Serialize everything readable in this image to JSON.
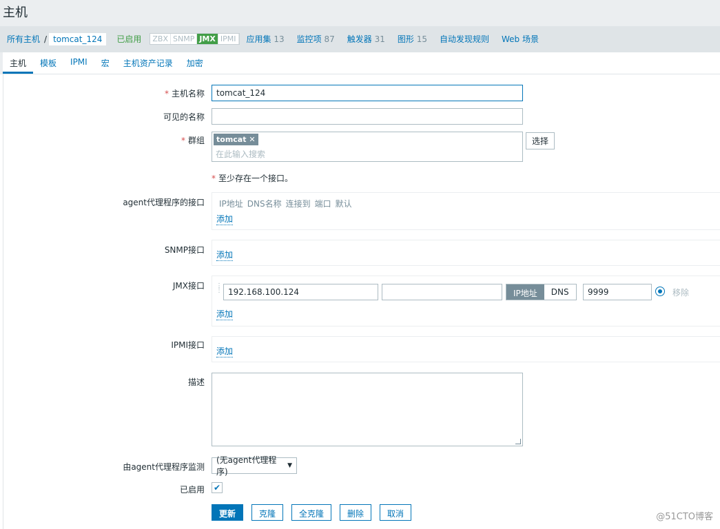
{
  "page_title": "主机",
  "breadcrumb": {
    "all_hosts": "所有主机",
    "sep": "/",
    "current_host": "tomcat_124",
    "status": "已启用",
    "availability": [
      "ZBX",
      "SNMP",
      "JMX",
      "IPMI"
    ],
    "links": [
      {
        "label": "应用集",
        "count": "13"
      },
      {
        "label": "监控项",
        "count": "87"
      },
      {
        "label": "触发器",
        "count": "31"
      },
      {
        "label": "图形",
        "count": "15"
      },
      {
        "label": "自动发现规则",
        "count": ""
      },
      {
        "label": "Web 场景",
        "count": ""
      }
    ]
  },
  "tabs": [
    "主机",
    "模板",
    "IPMI",
    "宏",
    "主机资产记录",
    "加密"
  ],
  "form": {
    "host_name_label": "主机名称",
    "host_name_value": "tomcat_124",
    "visible_name_label": "可见的名称",
    "visible_name_value": "",
    "groups_label": "群组",
    "group_tag": "tomcat",
    "groups_placeholder": "在此输入搜索",
    "select_button": "选择",
    "iface_required_note": "至少存在一个接口。",
    "agent_iface_label": "agent代理程序的接口",
    "iface_headers": [
      "IP地址",
      "DNS名称",
      "连接到",
      "端口",
      "默认"
    ],
    "add_label": "添加",
    "snmp_iface_label": "SNMP接口",
    "jmx_iface_label": "JMX接口",
    "jmx_ip": "192.168.100.124",
    "jmx_dns": "",
    "connect_ip": "IP地址",
    "connect_dns": "DNS",
    "jmx_port": "9999",
    "remove_label": "移除",
    "ipmi_iface_label": "IPMI接口",
    "description_label": "描述",
    "proxy_label": "由agent代理程序监测",
    "proxy_value": "(无agent代理程序)",
    "enabled_label": "已启用",
    "enabled_checked": true
  },
  "buttons": {
    "update": "更新",
    "clone": "克隆",
    "full_clone": "全克隆",
    "delete": "删除",
    "cancel": "取消"
  },
  "watermark": "@51CTO博客",
  "colors": {
    "accent": "#0275b8",
    "enabled_green": "#429e47",
    "required_red": "#d64e4e"
  }
}
